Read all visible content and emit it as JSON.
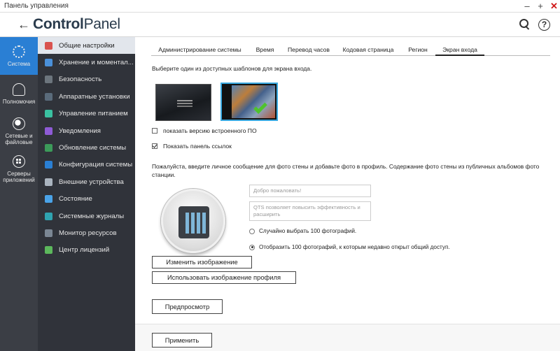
{
  "window": {
    "title": "Панель управления",
    "controls": [
      "‒",
      "+",
      "✕"
    ]
  },
  "header": {
    "logo_bold": "Control",
    "logo_light": "Panel"
  },
  "rail": [
    {
      "label": "Система",
      "icon": "gear-icon",
      "active": true
    },
    {
      "label": "Полномочия",
      "icon": "user-icon",
      "active": false
    },
    {
      "label": "Сетевые и файловые",
      "icon": "globe-icon",
      "active": false
    },
    {
      "label": "Серверы приложений",
      "icon": "apps-icon",
      "active": false
    }
  ],
  "nav": [
    {
      "label": "Общие настройки",
      "icon_color": "#d9534f",
      "active": true
    },
    {
      "label": "Хранение и моментал...",
      "icon_color": "#4a90d9"
    },
    {
      "label": "Безопасность",
      "icon_color": "#6c757d"
    },
    {
      "label": "Аппаратные установки",
      "icon_color": "#5a6b7b"
    },
    {
      "label": "Управление питанием",
      "icon_color": "#3ac1a1"
    },
    {
      "label": "Уведомления",
      "icon_color": "#8e5bd6"
    },
    {
      "label": "Обновление системы",
      "icon_color": "#3c9b5a"
    },
    {
      "label": "Конфигурация системы",
      "icon_color": "#2a7fd4"
    },
    {
      "label": "Внешние устройства",
      "icon_color": "#aab4bf"
    },
    {
      "label": "Состояние",
      "icon_color": "#4aa3e8"
    },
    {
      "label": "Системные журналы",
      "icon_color": "#2fa3b0"
    },
    {
      "label": "Монитор ресурсов",
      "icon_color": "#7b8794"
    },
    {
      "label": "Центр лицензий",
      "icon_color": "#5cb85c"
    }
  ],
  "tabs": [
    {
      "label": "Администрирование системы"
    },
    {
      "label": "Время"
    },
    {
      "label": "Перевод часов"
    },
    {
      "label": "Кодовая страница"
    },
    {
      "label": "Регион"
    },
    {
      "label": "Экран входа",
      "active": true
    }
  ],
  "content": {
    "instruction": "Выберите один из доступных шаблонов для экрана входа.",
    "cb_firmware": "показать версию встроенного ПО",
    "cb_firmware_checked": false,
    "cb_links": "Показать панель ссылок",
    "cb_links_checked": true,
    "para": "Пожалуйста, введите личное сообщение для фото стены и добавьте фото в профиль. Содержание фото стены из публичных альбомов фото станции.",
    "welcome_placeholder": "Добро пожаловать!",
    "message_placeholder": "QTS позволяет повысить эффективность и расширить",
    "radio_random": "Случайно выбрать 100 фотографий.",
    "radio_recent": "Отобразить 100 фотографий, к которым недавно открыт общий доступ.",
    "btn_change_image": "Изменить изображение",
    "btn_use_profile": "Использовать изображение профиля",
    "btn_preview": "Предпросмотр",
    "btn_apply": "Применить"
  }
}
